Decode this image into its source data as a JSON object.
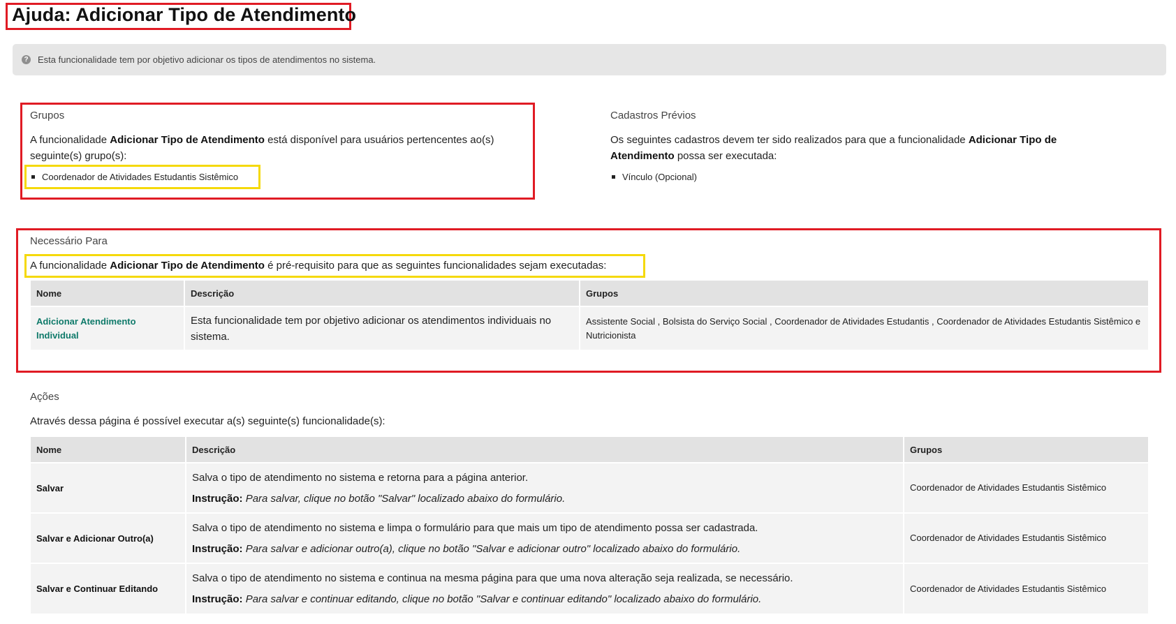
{
  "title": "Ajuda: Adicionar Tipo de Atendimento",
  "info": "Esta funcionalidade tem por objetivo adicionar os tipos de atendimentos no sistema.",
  "grupos": {
    "heading": "Grupos",
    "text_pre": "A funcionalidade",
    "text_bold": "Adicionar Tipo de Atendimento",
    "text_post": "está disponível para usuários pertencentes ao(s) seguinte(s) grupo(s):",
    "items": [
      "Coordenador de Atividades Estudantis Sistêmico"
    ]
  },
  "cadastros": {
    "heading": "Cadastros Prévios",
    "text_pre": "Os seguintes cadastros devem ter sido realizados para que a funcionalidade",
    "text_bold": "Adicionar Tipo de Atendimento",
    "text_post": "possa ser executada:",
    "items": [
      "Vínculo (Opcional)"
    ]
  },
  "necessario": {
    "heading": "Necessário Para",
    "text_pre": "A funcionalidade",
    "text_bold": "Adicionar Tipo de Atendimento",
    "text_post": "é pré-requisito para que as seguintes funcionalidades sejam executadas:",
    "columns": [
      "Nome",
      "Descrição",
      "Grupos"
    ],
    "rows": [
      {
        "name": "Adicionar Atendimento Individual",
        "description": "Esta funcionalidade tem por objetivo adicionar os atendimentos individuais no sistema.",
        "groups": "Assistente Social , Bolsista do Serviço Social , Coordenador de Atividades Estudantis , Coordenador de Atividades Estudantis Sistêmico e Nutricionista"
      }
    ]
  },
  "acoes": {
    "heading": "Ações",
    "text": "Através dessa página é possível executar a(s) seguinte(s) funcionalidade(s):",
    "columns": [
      "Nome",
      "Descrição",
      "Grupos"
    ],
    "instruction_label": "Instrução:",
    "rows": [
      {
        "name": "Salvar",
        "description": "Salva o tipo de atendimento no sistema e retorna para a página anterior.",
        "instruction": "Para salvar, clique no botão \"Salvar\" localizado abaixo do formulário.",
        "groups": "Coordenador de Atividades Estudantis Sistêmico"
      },
      {
        "name": "Salvar e Adicionar Outro(a)",
        "description": "Salva o tipo de atendimento no sistema e limpa o formulário para que mais um tipo de atendimento possa ser cadastrada.",
        "instruction": "Para salvar e adicionar outro(a), clique no botão \"Salvar e adicionar outro\" localizado abaixo do formulário.",
        "groups": "Coordenador de Atividades Estudantis Sistêmico"
      },
      {
        "name": "Salvar e Continuar Editando",
        "description": "Salva o tipo de atendimento no sistema e continua na mesma página para que uma nova alteração seja realizada, se necessário.",
        "instruction": "Para salvar e continuar editando, clique no botão \"Salvar e continuar editando\" localizado abaixo do formulário.",
        "groups": "Coordenador de Atividades Estudantis Sistêmico"
      }
    ]
  },
  "colors": {
    "highlight_red": "#e01b24",
    "highlight_yellow": "#f5d90a",
    "link": "#0f7a6a"
  }
}
